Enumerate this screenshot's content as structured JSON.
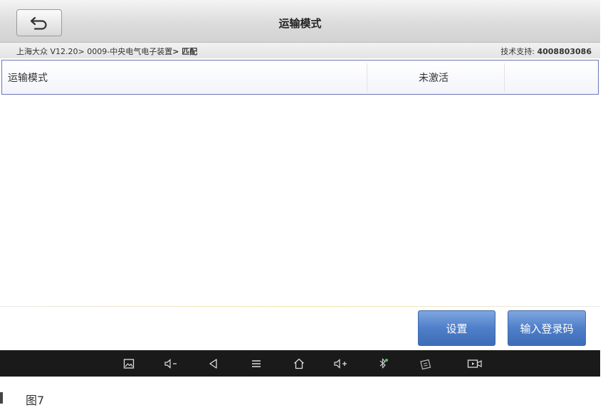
{
  "header": {
    "title": "运输模式",
    "breadcrumb_path": "上海大众 V12.20> 0009-中央电气电子装置",
    "breadcrumb_current": "> 匹配",
    "support_label": "技术支持:",
    "support_number": "4008803086"
  },
  "table": {
    "rows": [
      {
        "name": "运输模式",
        "value": "未激活"
      }
    ]
  },
  "buttons": {
    "settings": "设置",
    "enter_login_code": "输入登录码"
  },
  "navbar": {
    "icons": [
      "screenshot-icon",
      "volume-down-icon",
      "back-icon",
      "menu-icon",
      "home-icon",
      "volume-up-icon",
      "bluetooth-icon",
      "vci-icon",
      "screen-record-icon"
    ]
  },
  "caption": "图7"
}
